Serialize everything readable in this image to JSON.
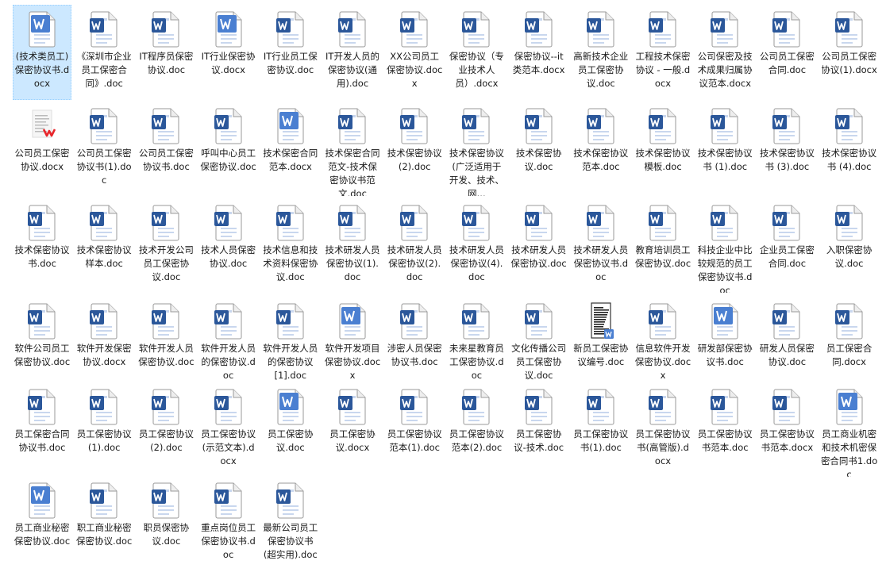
{
  "colors": {
    "word_blue": "#2b579a",
    "word_blue_light": "#4a7fd1",
    "selection_bg": "#cce8ff",
    "wps_red": "#e8262b"
  },
  "selected_index": 0,
  "files": [
    {
      "name": "(技术类员工)保密协议书.docx",
      "icon": "word-doc-icon"
    },
    {
      "name": "《深圳市企业员工保密合同》.doc",
      "icon": "word-doc-icon"
    },
    {
      "name": "IT程序员保密协议.doc",
      "icon": "word-doc-icon"
    },
    {
      "name": "IT行业保密协议.docx",
      "icon": "word-doc-icon"
    },
    {
      "name": "IT行业员工保密协议.doc",
      "icon": "word-doc-icon"
    },
    {
      "name": "IT开发人员的保密协议(通用).doc",
      "icon": "word-doc-icon"
    },
    {
      "name": "XX公司员工保密协议.docx",
      "icon": "word-doc-icon"
    },
    {
      "name": "保密协议（专业技术人员）.docx",
      "icon": "word-doc-icon"
    },
    {
      "name": "保密协议--it类范本.docx",
      "icon": "word-doc-icon"
    },
    {
      "name": "高新技术企业员工保密协议.doc",
      "icon": "word-doc-icon"
    },
    {
      "name": "工程技术保密协议 - 一般.docx",
      "icon": "word-doc-icon"
    },
    {
      "name": "公司保密及技术成果归属协议范本.docx",
      "icon": "word-doc-icon"
    },
    {
      "name": "公司员工保密合同.doc",
      "icon": "word-doc-icon"
    },
    {
      "name": "公司员工保密协议(1).docx",
      "icon": "word-doc-icon"
    },
    {
      "name": "公司员工保密协议.docx",
      "icon": "wps-doc-thumbnail-icon"
    },
    {
      "name": "公司员工保密协议书(1).doc",
      "icon": "word-doc-icon"
    },
    {
      "name": "公司员工保密协议书.doc",
      "icon": "word-doc-icon"
    },
    {
      "name": "呼叫中心员工保密协议.doc",
      "icon": "word-doc-icon"
    },
    {
      "name": "技术保密合同范本.docx",
      "icon": "word-doc-icon"
    },
    {
      "name": "技术保密合同范文-技术保密协议书范文.doc",
      "icon": "word-doc-icon"
    },
    {
      "name": "技术保密协议 (2).doc",
      "icon": "word-doc-icon"
    },
    {
      "name": "技术保密协议(广泛适用于开发、技术、网...",
      "icon": "word-doc-icon"
    },
    {
      "name": "技术保密协议.doc",
      "icon": "word-doc-icon"
    },
    {
      "name": "技术保密协议范本.doc",
      "icon": "word-doc-icon"
    },
    {
      "name": "技术保密协议模板.doc",
      "icon": "word-doc-icon"
    },
    {
      "name": "技术保密协议书 (1).doc",
      "icon": "word-doc-icon"
    },
    {
      "name": "技术保密协议书 (3).doc",
      "icon": "word-doc-icon"
    },
    {
      "name": "技术保密协议书 (4).doc",
      "icon": "word-doc-icon"
    },
    {
      "name": "技术保密协议书.doc",
      "icon": "word-doc-icon"
    },
    {
      "name": "技术保密协议样本.doc",
      "icon": "word-doc-icon"
    },
    {
      "name": "技术开发公司员工保密协议.doc",
      "icon": "word-doc-icon"
    },
    {
      "name": "技术人员保密协议.doc",
      "icon": "word-doc-icon"
    },
    {
      "name": "技术信息和技术资料保密协议.doc",
      "icon": "word-doc-icon"
    },
    {
      "name": "技术研发人员保密协议(1).doc",
      "icon": "word-doc-icon"
    },
    {
      "name": "技术研发人员保密协议(2).doc",
      "icon": "word-doc-icon"
    },
    {
      "name": "技术研发人员保密协议(4).doc",
      "icon": "word-doc-icon"
    },
    {
      "name": "技术研发人员保密协议.doc",
      "icon": "word-doc-icon"
    },
    {
      "name": "技术研发人员保密协议书.doc",
      "icon": "word-doc-icon"
    },
    {
      "name": "教育培训员工保密协议.doc",
      "icon": "word-doc-icon"
    },
    {
      "name": "科技企业中比较规范的员工保密协议书.doc",
      "icon": "word-doc-icon"
    },
    {
      "name": "企业员工保密合同.doc",
      "icon": "word-doc-icon"
    },
    {
      "name": "入职保密协议.doc",
      "icon": "word-doc-icon"
    },
    {
      "name": "软件公司员工保密协议.doc",
      "icon": "word-doc-icon"
    },
    {
      "name": "软件开发保密协议.docx",
      "icon": "word-doc-icon"
    },
    {
      "name": "软件开发人员保密协议.doc",
      "icon": "word-doc-icon"
    },
    {
      "name": "软件开发人员的保密协议.doc",
      "icon": "word-doc-icon"
    },
    {
      "name": "软件开发人员的保密协议[1].doc",
      "icon": "word-doc-icon"
    },
    {
      "name": "软件开发项目保密协议.docx",
      "icon": "word-doc-icon"
    },
    {
      "name": "涉密人员保密协议书.doc",
      "icon": "word-doc-icon"
    },
    {
      "name": "未来星教育员工保密协议.doc",
      "icon": "word-doc-icon"
    },
    {
      "name": "文化传播公司员工保密协议.doc",
      "icon": "word-doc-icon"
    },
    {
      "name": "新员工保密协议编号.doc",
      "icon": "scan-doc-thumbnail-icon"
    },
    {
      "name": "信息软件开发保密协议.docx",
      "icon": "word-doc-icon"
    },
    {
      "name": "研发部保密协议书.doc",
      "icon": "word-doc-icon"
    },
    {
      "name": "研发人员保密协议.doc",
      "icon": "word-doc-icon"
    },
    {
      "name": "员工保密合同.docx",
      "icon": "word-doc-icon"
    },
    {
      "name": "员工保密合同协议书.doc",
      "icon": "word-doc-icon"
    },
    {
      "name": "员工保密协议 (1).doc",
      "icon": "word-doc-icon"
    },
    {
      "name": "员工保密协议 (2).doc",
      "icon": "word-doc-icon"
    },
    {
      "name": "员工保密协议(示范文本).docx",
      "icon": "word-doc-icon"
    },
    {
      "name": "员工保密协议.doc",
      "icon": "word-doc-icon"
    },
    {
      "name": "员工保密协议.docx",
      "icon": "word-doc-icon"
    },
    {
      "name": "员工保密协议范本(1).doc",
      "icon": "word-doc-icon"
    },
    {
      "name": "员工保密协议范本(2).doc",
      "icon": "word-doc-icon"
    },
    {
      "name": "员工保密协议-技术.doc",
      "icon": "word-doc-icon"
    },
    {
      "name": "员工保密协议书(1).doc",
      "icon": "word-doc-icon"
    },
    {
      "name": "员工保密协议书(高管版).docx",
      "icon": "word-doc-icon"
    },
    {
      "name": "员工保密协议书范本.doc",
      "icon": "word-doc-icon"
    },
    {
      "name": "员工保密协议书范本.docx",
      "icon": "word-doc-icon"
    },
    {
      "name": "员工商业机密和技术机密保密合同书1.doc",
      "icon": "word-doc-icon"
    },
    {
      "name": "员工商业秘密保密协议.doc",
      "icon": "word-doc-icon"
    },
    {
      "name": "职工商业秘密保密协议.doc",
      "icon": "word-doc-icon"
    },
    {
      "name": "职员保密协议.doc",
      "icon": "word-doc-icon"
    },
    {
      "name": "重点岗位员工保密协议书.doc",
      "icon": "word-doc-icon"
    },
    {
      "name": "最新公司员工保密协议书(超实用).doc",
      "icon": "word-doc-icon"
    }
  ]
}
